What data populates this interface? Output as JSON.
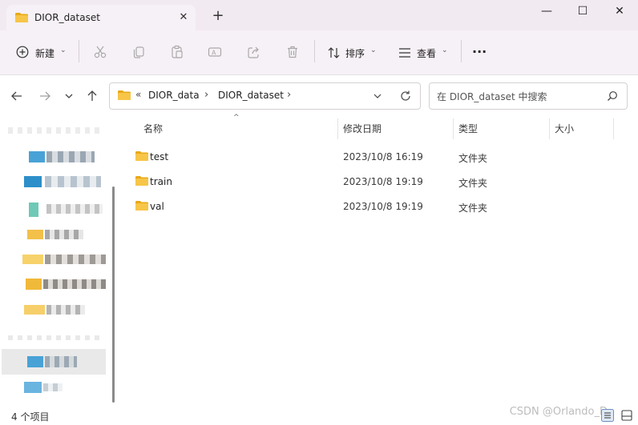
{
  "tab": {
    "title": "DIOR_dataset",
    "close": "✕",
    "new": "+"
  },
  "window": {
    "minimize": "—",
    "maximize": "☐",
    "close": "✕"
  },
  "toolbar": {
    "new_label": "新建",
    "sort_label": "排序",
    "view_label": "查看",
    "more": "···"
  },
  "address": {
    "overflow": "«",
    "crumbs": [
      "DIOR_data",
      "DIOR_dataset"
    ],
    "sep": "›"
  },
  "search": {
    "placeholder": "在 DIOR_dataset 中搜索"
  },
  "columns": {
    "name": "名称",
    "modified": "修改日期",
    "type": "类型",
    "size": "大小"
  },
  "files": [
    {
      "name": "test",
      "modified": "2023/10/8 16:19",
      "type": "文件夹"
    },
    {
      "name": "train",
      "modified": "2023/10/8 19:19",
      "type": "文件夹"
    },
    {
      "name": "val",
      "modified": "2023/10/8 19:19",
      "type": "文件夹"
    }
  ],
  "status": {
    "count": "4 个项目"
  },
  "watermark": "CSDN @Orlando_D",
  "colors": {
    "folder": "#f7c548",
    "folder_dark": "#e8a917",
    "tab_bg": "#f2eaf1",
    "cmd_bg": "#f6f1f6"
  }
}
